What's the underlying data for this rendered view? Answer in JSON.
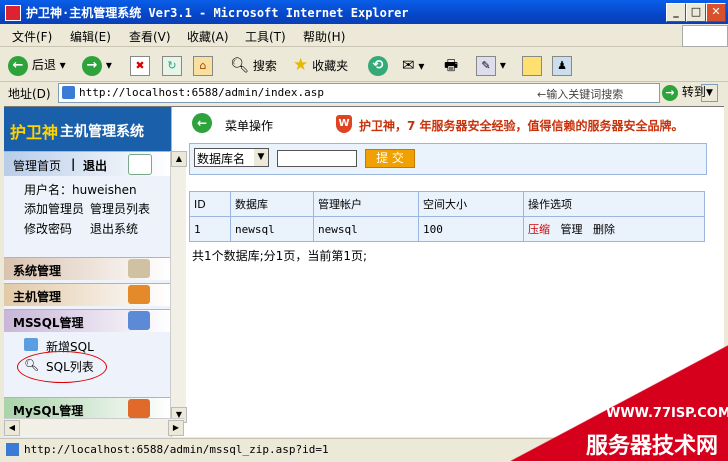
{
  "window": {
    "title": "护卫神·主机管理系统 Ver3.1 - Microsoft Internet Explorer"
  },
  "menu": [
    "文件(F)",
    "编辑(E)",
    "查看(V)",
    "收藏(A)",
    "工具(T)",
    "帮助(H)"
  ],
  "toolbar": {
    "back": "后退",
    "search": "搜索",
    "favorites": "收藏夹"
  },
  "address": {
    "label": "地址(D)",
    "url": "http://localhost:6588/admin/index.asp",
    "hint": "←输入关键词搜索",
    "go": "转到"
  },
  "sidebar": {
    "brand_name": "护卫神",
    "brand_sub": "主机管理系统",
    "nav_home": "管理首页",
    "nav_sep": "|",
    "nav_logout": "退出",
    "user_label": "用户名：huweishen",
    "links": [
      "添加管理员",
      "管理员列表",
      "修改密码",
      "退出系统"
    ],
    "sections": [
      "系统管理",
      "主机管理",
      "MSSQL管理",
      "MySQL管理"
    ],
    "mssql_items": [
      "新增SQL",
      "SQL列表"
    ]
  },
  "main": {
    "op_title": "菜单操作",
    "slogan": "护卫神，7 年服务器安全经验，值得信赖的服务器安全品牌。",
    "search": {
      "select_value": "数据库名",
      "submit": "提 交"
    },
    "table": {
      "headers": [
        "ID",
        "数据库",
        "管理帐户",
        "空间大小",
        "操作选项"
      ],
      "rows": [
        {
          "id": "1",
          "db": "newsql",
          "account": "newsql",
          "size": "100",
          "ops": [
            "压缩",
            "管理",
            "删除"
          ]
        }
      ]
    },
    "pager": "共1个数据库;分1页，当前第1页;"
  },
  "status": {
    "url": "http://localhost:6588/admin/mssql_zip.asp?id=1"
  },
  "watermark": {
    "url": "WWW.77ISP.COM",
    "name": "服务器技术网"
  },
  "colors": {
    "titlebar": "#0a5ee8",
    "brand_bg": "#1a5fa9",
    "brand_yellow": "#ffd200",
    "slogan": "#c8320a",
    "submit_bg": "#f0a000",
    "link_red": "#cc0000",
    "watermark": "#d6001c"
  }
}
